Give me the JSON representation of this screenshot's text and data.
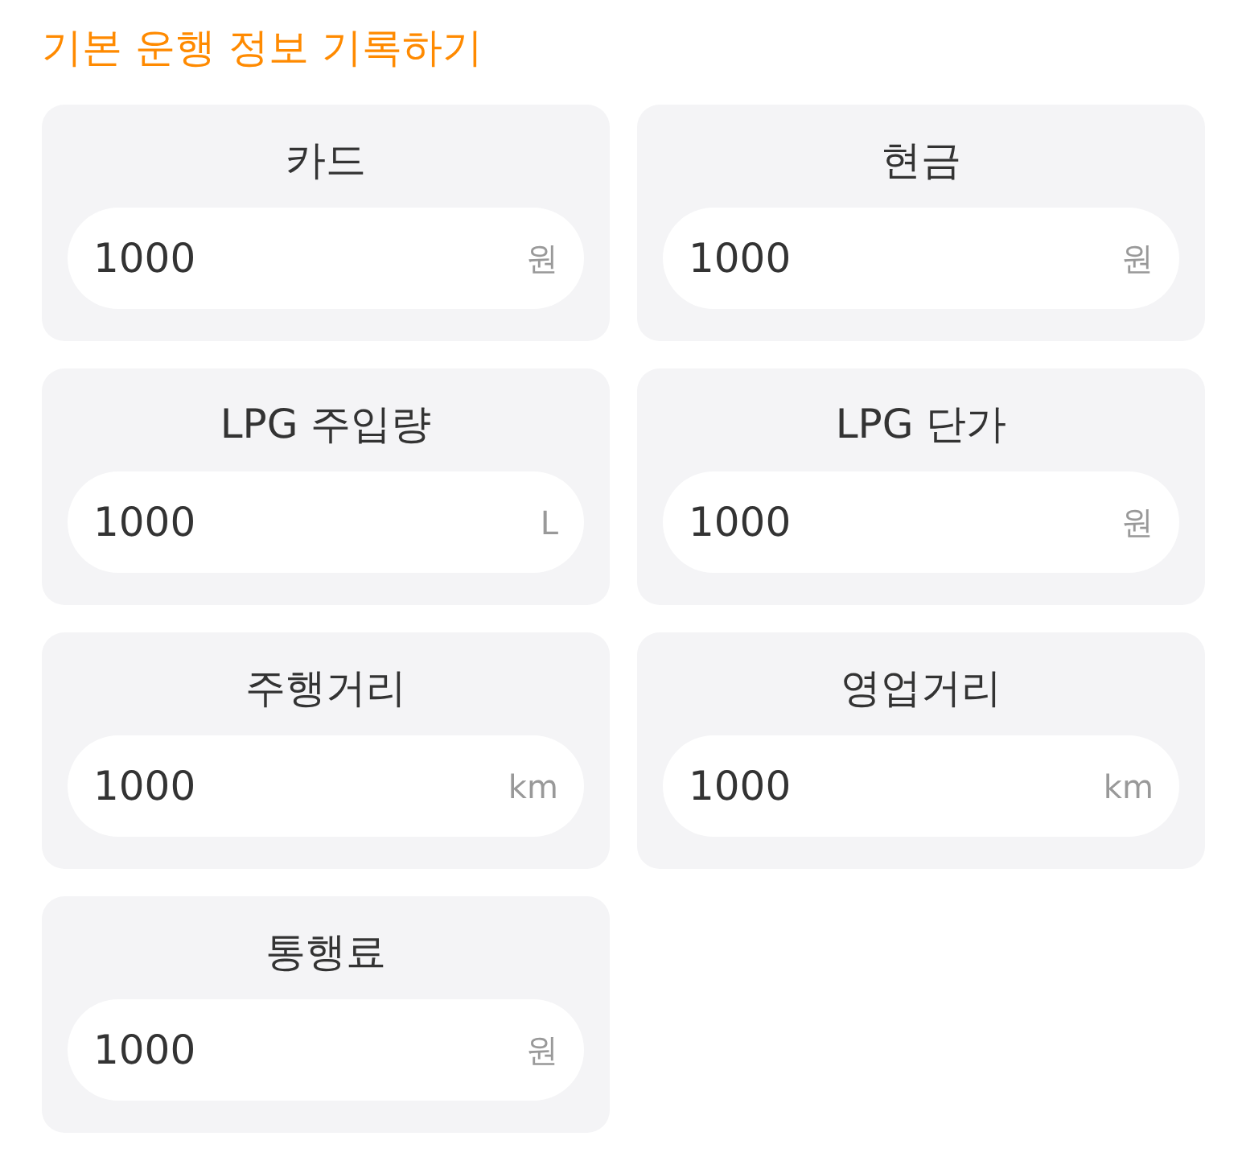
{
  "title": "기본 운행 정보 기록하기",
  "fields": [
    {
      "label": "카드",
      "value": "1000",
      "unit": "원"
    },
    {
      "label": "현금",
      "value": "1000",
      "unit": "원"
    },
    {
      "label": "LPG 주입량",
      "value": "1000",
      "unit": "L"
    },
    {
      "label": "LPG 단가",
      "value": "1000",
      "unit": "원"
    },
    {
      "label": "주행거리",
      "value": "1000",
      "unit": "km"
    },
    {
      "label": "영업거리",
      "value": "1000",
      "unit": "km"
    },
    {
      "label": "통행료",
      "value": "1000",
      "unit": "원"
    }
  ]
}
